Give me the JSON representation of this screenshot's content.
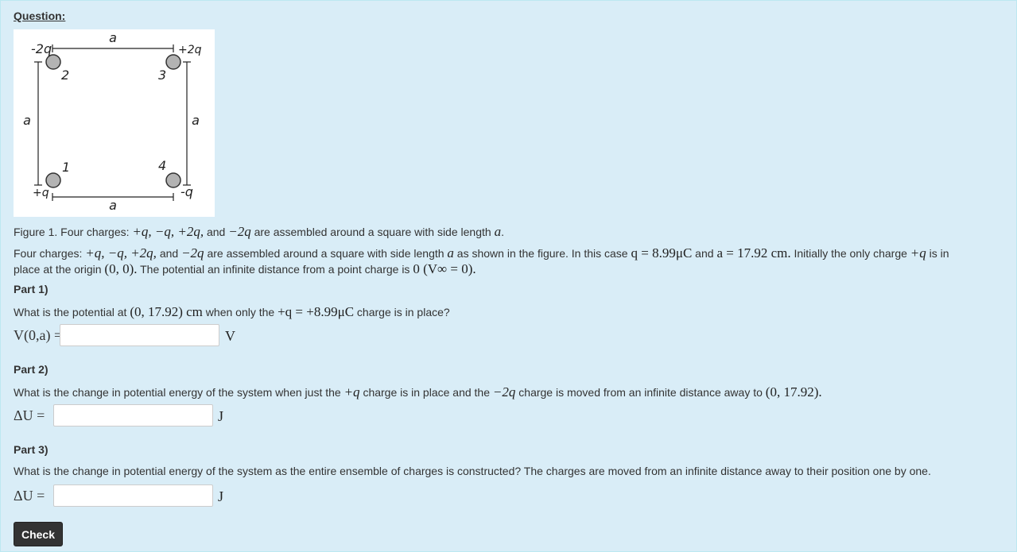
{
  "heading": "Question:",
  "figure": {
    "labels": {
      "top_side": "a",
      "bottom_side": "a",
      "left_side": "a",
      "right_side": "a",
      "charge_top_left": "-2q",
      "charge_top_right": "+2q",
      "charge_bottom_left": "+q",
      "charge_bottom_right": "-q",
      "num_top_left": "2",
      "num_top_right": "3",
      "num_bottom_left": "1",
      "num_bottom_right": "4"
    },
    "caption_pre": "Figure 1. Four charges: ",
    "caption_math": "+q, −q, +2q,",
    "caption_and": " and ",
    "caption_math2": "−2q",
    "caption_post": " are assembled around a square with side length ",
    "caption_a": "a",
    "caption_end": "."
  },
  "intro": {
    "t1": "Four charges: ",
    "m1": "+q, −q, +2q,",
    "t2": " and ",
    "m2": "−2q",
    "t3": " are assembled around a square with side length ",
    "m3": "a",
    "t4": " as shown in the figure. In this case ",
    "m4": "q = 8.99μC",
    "t5": " and ",
    "m5": "a = 17.92 cm.",
    "t6": " Initially the only charge ",
    "m6": "+q",
    "t7": " is in",
    "line2_t1": "place at the origin ",
    "line2_m1": "(0, 0).",
    "line2_t2": " The potential an infinite distance from a point charge is ",
    "line2_m2": "0 (V∞ = 0)."
  },
  "part1": {
    "title": "Part 1)",
    "q_t1": "What is the potential at ",
    "q_m1": "(0, 17.92) cm",
    "q_t2": " when only the ",
    "q_m2": "+q = +8.99μC",
    "q_t3": " charge is in place?",
    "label": "V(0,a) =",
    "value": "",
    "unit": "V"
  },
  "part2": {
    "title": "Part 2)",
    "q_t1": "What is the change in potential energy of the system when just the ",
    "q_m1": "+q",
    "q_t2": " charge is in place and the ",
    "q_m2": "−2q",
    "q_t3": " charge is moved from an infinite distance away to ",
    "q_m3": "(0, 17.92).",
    "label": "ΔU =",
    "value": "",
    "unit": "J"
  },
  "part3": {
    "title": "Part 3)",
    "question": "What is the change in potential energy of the system as the entire ensemble of charges is constructed? The charges are moved from an infinite distance away to their position one by one.",
    "label": "ΔU =",
    "value": "",
    "unit": "J"
  },
  "check_button": "Check"
}
